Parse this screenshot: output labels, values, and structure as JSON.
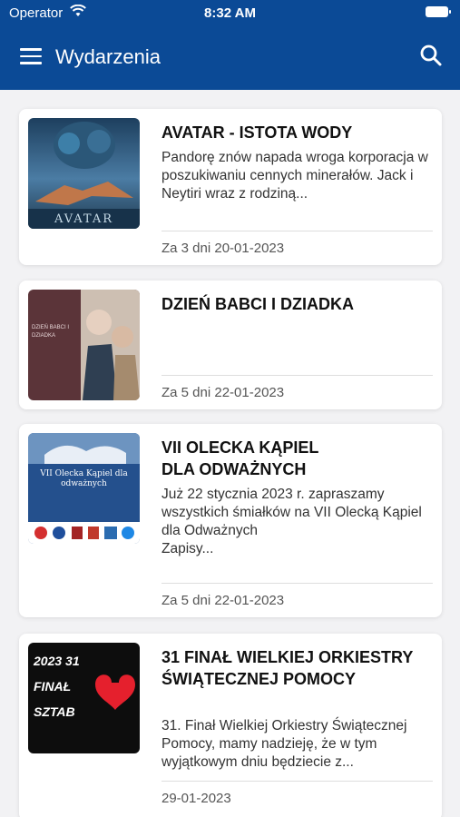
{
  "status_bar": {
    "carrier": "Operator",
    "time": "8:32 AM"
  },
  "header": {
    "title": "Wydarzenia",
    "menu_icon": "hamburger-menu-icon",
    "search_icon": "search-icon"
  },
  "events": [
    {
      "title": "AVATAR - ISTOTA WODY",
      "description": "Pandorę znów napada wroga korporacja w poszukiwaniu cennych minerałów. Jack i Neytiri wraz z rodziną...",
      "date": "Za 3 dni 20-01-2023",
      "thumbnail_text": "AVATAR"
    },
    {
      "title": "DZIEŃ BABCI I DZIADKA",
      "description": "",
      "date": "Za 5 dni 22-01-2023",
      "thumbnail_text": "DZIEŃ BABCI I DZIADKA"
    },
    {
      "title": "VII OLECKA KĄPIEL DLA ODWAŻNYCH",
      "description": "Już 22 stycznia 2023 r. zapraszamy wszystkich śmiałków na VII Olecką Kąpiel dla Odważnych",
      "description_extra": "Zapisy...",
      "date": "Za 5 dni 22-01-2023",
      "thumbnail_text": "VII Olecka Kąpiel dla odważnych"
    },
    {
      "title": "31 FINAŁ WIELKIEJ ORKIESTRY ŚWIĄTECZNEJ POMOCY",
      "description": "31. Finał Wielkiej Orkiestry Świątecznej Pomocy, mamy nadzieję, że w tym wyjątkowym dniu będziecie z...",
      "date": "29-01-2023",
      "thumbnail_text": "2023 31 FINAŁ SZTAB"
    }
  ]
}
